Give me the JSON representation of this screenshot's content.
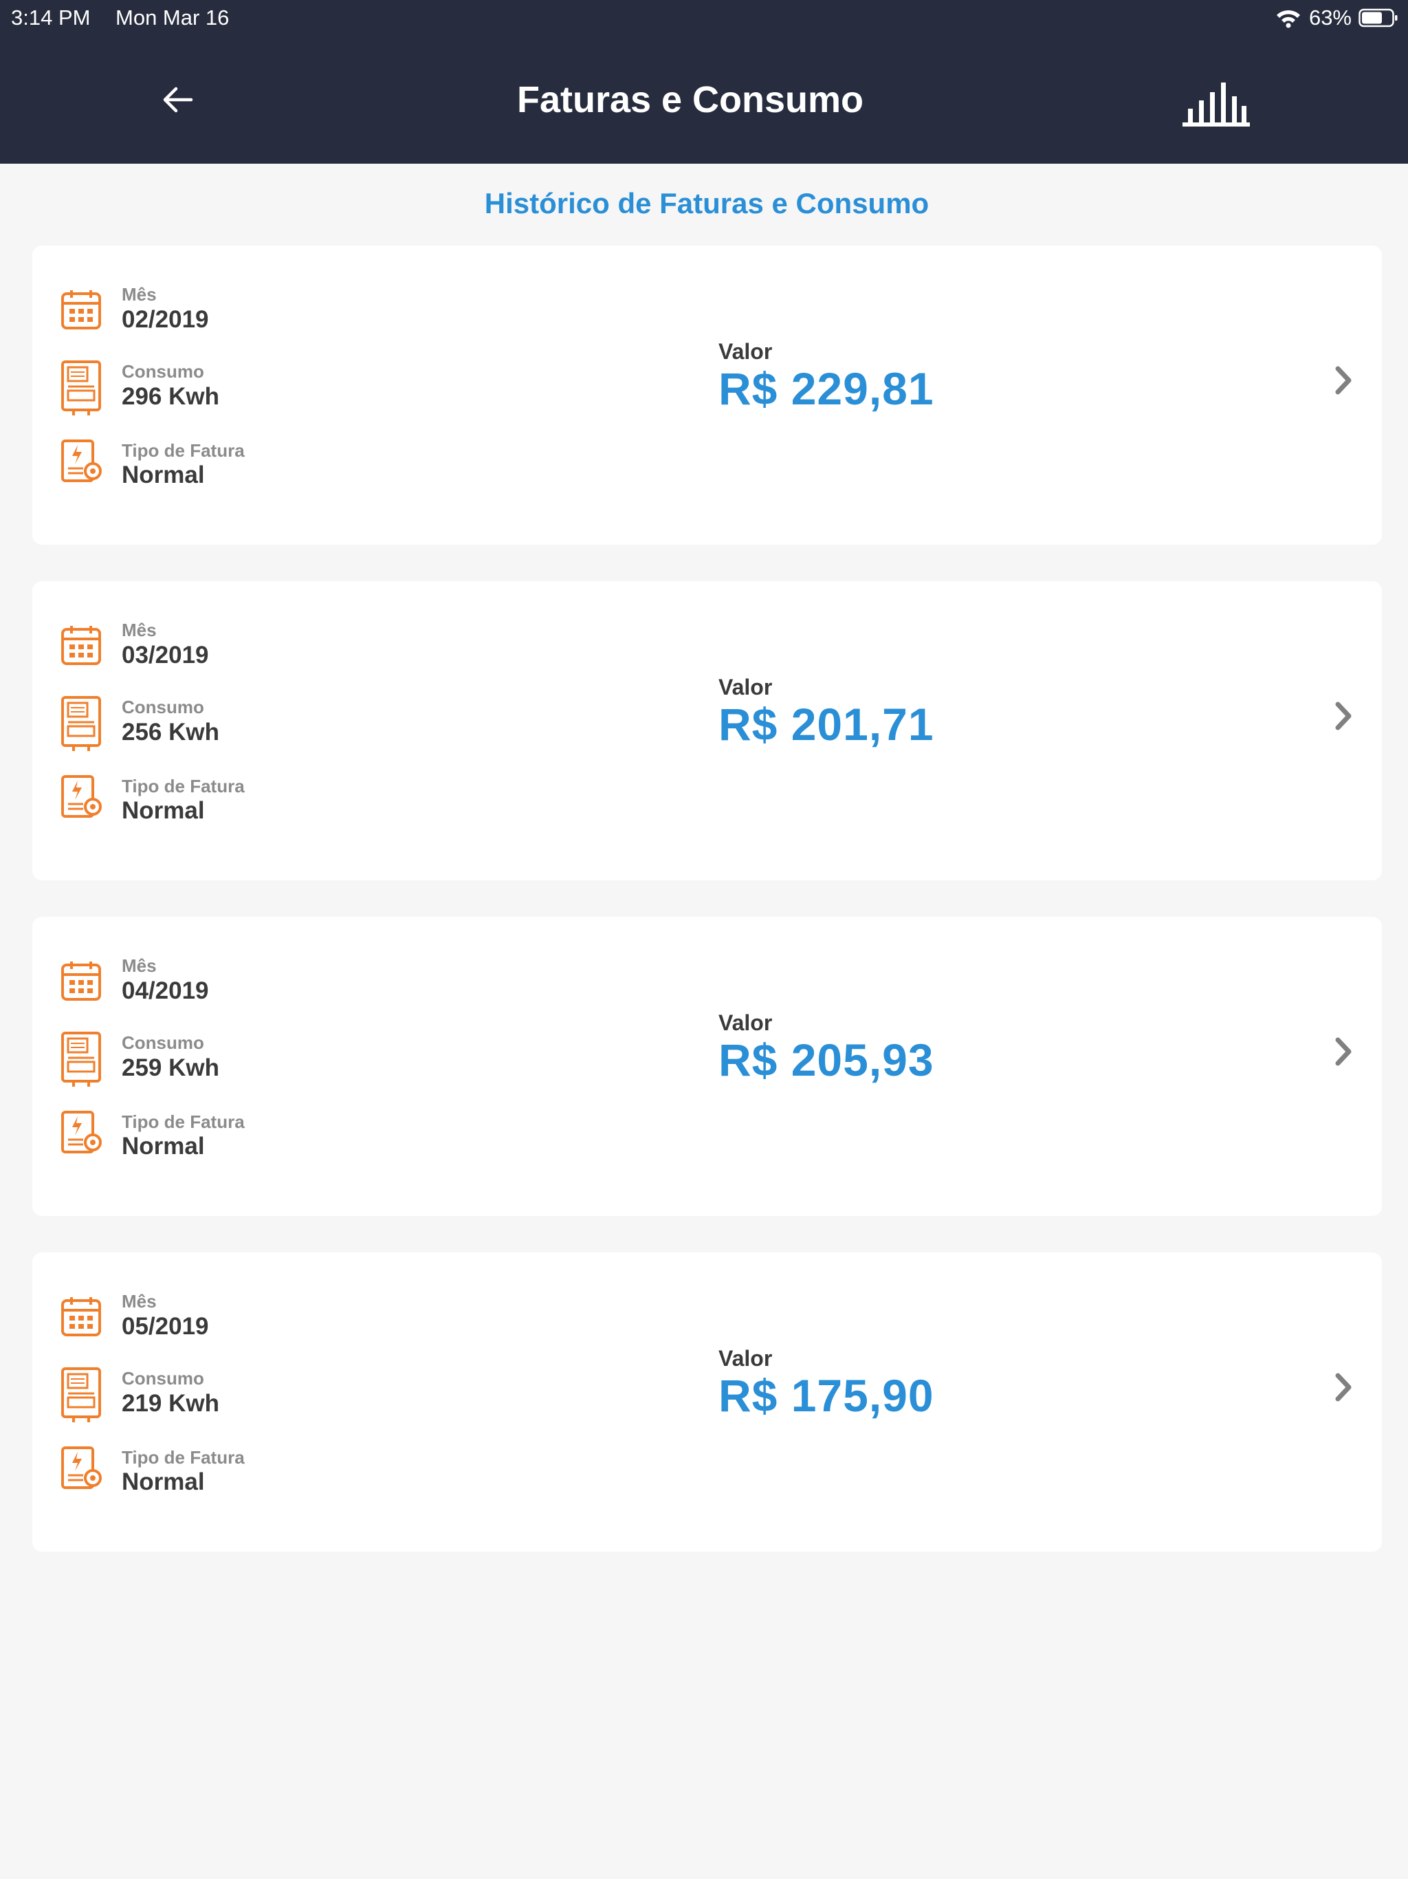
{
  "status_bar": {
    "time": "3:14 PM",
    "date": "Mon Mar 16",
    "battery": "63%"
  },
  "nav": {
    "title": "Faturas e Consumo"
  },
  "section_title": "Histórico de Faturas e Consumo",
  "labels": {
    "month": "Mês",
    "consumption": "Consumo",
    "invoice_type": "Tipo de Fatura",
    "amount": "Valor"
  },
  "colors": {
    "accent": "#2a8fd6",
    "icon": "#f07f2c",
    "header": "#272c3e"
  },
  "invoices": [
    {
      "month": "02/2019",
      "consumption": "296 Kwh",
      "type": "Normal",
      "amount": "R$ 229,81"
    },
    {
      "month": "03/2019",
      "consumption": "256 Kwh",
      "type": "Normal",
      "amount": "R$ 201,71"
    },
    {
      "month": "04/2019",
      "consumption": "259 Kwh",
      "type": "Normal",
      "amount": "R$ 205,93"
    },
    {
      "month": "05/2019",
      "consumption": "219 Kwh",
      "type": "Normal",
      "amount": "R$ 175,90"
    }
  ]
}
